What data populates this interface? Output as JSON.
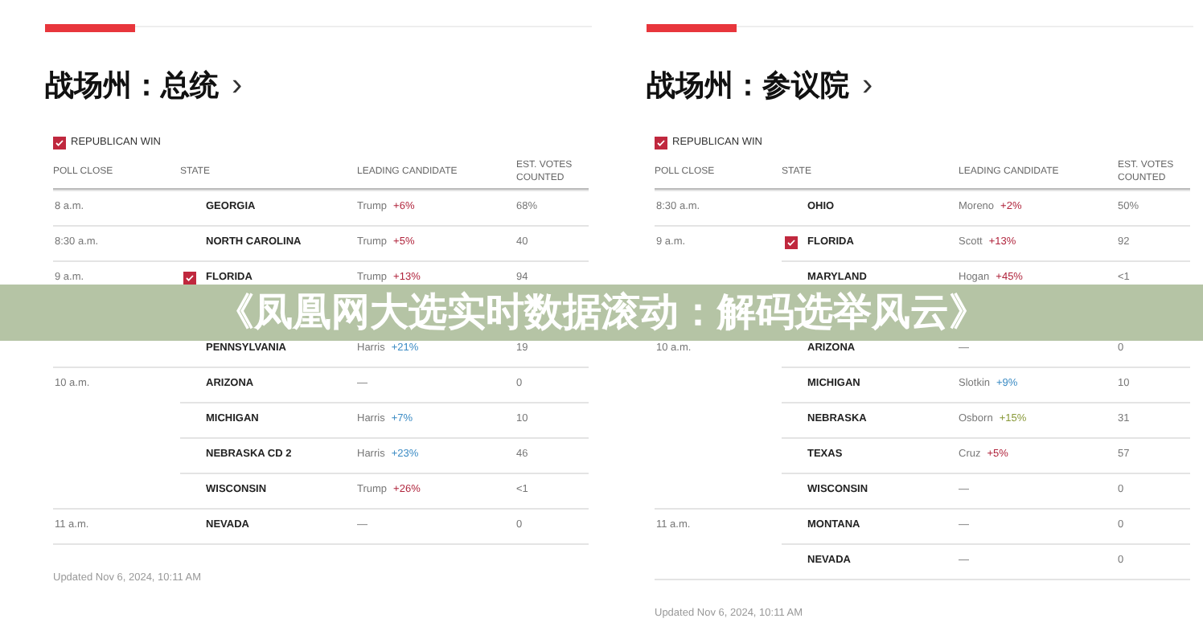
{
  "panels": [
    {
      "title": "战场州：总统",
      "chevron": "›",
      "legend": {
        "label": "REPUBLICAN WIN",
        "checked": true
      },
      "columns": [
        "POLL CLOSE",
        "STATE",
        "LEADING CANDIDATE",
        "EST. VOTES COUNTED"
      ],
      "rows": [
        {
          "poll_close": "8 a.m.",
          "state": "GEORGIA",
          "republican_win": false,
          "candidate": "Trump",
          "margin": "+6%",
          "kind": "republican",
          "votes": "68%"
        },
        {
          "poll_close": "8:30 a.m.",
          "state": "NORTH CAROLINA",
          "republican_win": false,
          "candidate": "Trump",
          "margin": "+5%",
          "kind": "republican",
          "votes": "40"
        },
        {
          "poll_close": "9 a.m.",
          "state": "FLORIDA",
          "republican_win": true,
          "candidate": "Trump",
          "margin": "+13%",
          "kind": "republican",
          "votes": "94"
        },
        {
          "state": "PENNSYLVANIA",
          "republican_win": false,
          "candidate": "Harris",
          "margin": "+21%",
          "kind": "democrat",
          "votes": "19"
        },
        {
          "poll_close": "10 a.m.",
          "state": "ARIZONA",
          "republican_win": false,
          "candidate": "—",
          "votes": "0"
        },
        {
          "state": "MICHIGAN",
          "republican_win": false,
          "candidate": "Harris",
          "margin": "+7%",
          "kind": "democrat",
          "votes": "10"
        },
        {
          "state": "NEBRASKA CD 2",
          "republican_win": false,
          "candidate": "Harris",
          "margin": "+23%",
          "kind": "democrat",
          "votes": "46"
        },
        {
          "state": "WISCONSIN",
          "republican_win": false,
          "candidate": "Trump",
          "margin": "+26%",
          "kind": "republican",
          "votes": "<1"
        },
        {
          "poll_close": "11 a.m.",
          "state": "NEVADA",
          "republican_win": false,
          "candidate": "—",
          "votes": "0"
        }
      ],
      "updated": "Updated Nov 6, 2024, 10:11 AM"
    },
    {
      "title": "战场州：参议院",
      "chevron": "›",
      "legend": {
        "label": "REPUBLICAN WIN",
        "checked": true
      },
      "columns": [
        "POLL CLOSE",
        "STATE",
        "LEADING CANDIDATE",
        "EST. VOTES COUNTED"
      ],
      "rows": [
        {
          "poll_close": "8:30 a.m.",
          "state": "OHIO",
          "republican_win": false,
          "candidate": "Moreno",
          "margin": "+2%",
          "kind": "republican",
          "votes": "50%"
        },
        {
          "poll_close": "9 a.m.",
          "state": "FLORIDA",
          "republican_win": true,
          "candidate": "Scott",
          "margin": "+13%",
          "kind": "republican",
          "votes": "92"
        },
        {
          "state": "MARYLAND",
          "republican_win": false,
          "candidate": "Hogan",
          "margin": "+45%",
          "kind": "republican",
          "votes": "<1"
        },
        {
          "poll_close": "10 a.m.",
          "state": "ARIZONA",
          "republican_win": false,
          "candidate": "—",
          "votes": "0"
        },
        {
          "state": "MICHIGAN",
          "republican_win": false,
          "candidate": "Slotkin",
          "margin": "+9%",
          "kind": "democrat",
          "votes": "10"
        },
        {
          "state": "NEBRASKA",
          "republican_win": false,
          "candidate": "Osborn",
          "margin": "+15%",
          "kind": "independent",
          "votes": "31"
        },
        {
          "state": "TEXAS",
          "republican_win": false,
          "candidate": "Cruz",
          "margin": "+5%",
          "kind": "republican",
          "votes": "57"
        },
        {
          "state": "WISCONSIN",
          "republican_win": false,
          "candidate": "—",
          "votes": "0"
        },
        {
          "poll_close": "11 a.m.",
          "state": "MONTANA",
          "republican_win": false,
          "candidate": "—",
          "votes": "0"
        },
        {
          "state": "NEVADA",
          "republican_win": false,
          "candidate": "—",
          "votes": "0"
        }
      ],
      "updated": "Updated Nov 6, 2024, 10:11 AM"
    }
  ],
  "banner": {
    "title": "《凤凰网大选实时数据滚动：解码选举风云》"
  }
}
